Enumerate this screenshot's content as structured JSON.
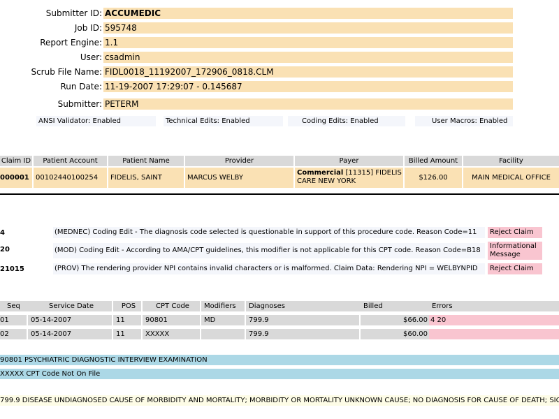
{
  "info": [
    {
      "label": "Submitter ID:",
      "value": "ACCUMEDIC",
      "bold": true
    },
    {
      "label": "Job ID:",
      "value": "595748"
    },
    {
      "label": "Report Engine:",
      "value": "1.1"
    },
    {
      "label": "User:",
      "value": "csadmin"
    },
    {
      "label": "Scrub File Name:",
      "value": "FIDL0018_11192007_172906_0818.CLM"
    },
    {
      "label": "Run Date:",
      "value": "11-19-2007 17:29:07 - 0.145687"
    },
    {
      "label": "Submitter:",
      "value": "PETERM"
    }
  ],
  "status": {
    "ansi": "ANSI Validator: Enabled",
    "technical": "Technical Edits: Enabled",
    "coding": "Coding Edits: Enabled",
    "macros": "User Macros: Enabled"
  },
  "claim_table": {
    "headers": [
      "Claim ID",
      "Patient Account",
      "Patient Name",
      "Provider",
      "Payer",
      "Billed Amount",
      "Facility"
    ],
    "row": {
      "claim_id": "000001",
      "patient_account": "00102440100254",
      "patient_name": "FIDELIS, SAINT",
      "provider": "MARCUS WELBY",
      "payer_bold": "Commercial",
      "payer_line1": " [11315] FIDELIS",
      "payer_line2": "CARE NEW YORK",
      "billed": "$126.00",
      "facility": "MAIN MEDICAL OFFICE"
    }
  },
  "errors": [
    {
      "code": "4",
      "message": "(MEDNEC) Coding Edit - The diagnosis code selected is questionable in support of this procedure code. Reason Code=11",
      "action": "Reject Claim"
    },
    {
      "code": "20",
      "message": "(MOD) Coding Edit - According to AMA/CPT guidelines, this modifier is not applicable for this CPT code. Reason Code=B18",
      "action": "Informational Message"
    },
    {
      "code": "21015",
      "message": "(PROV) The rendering provider NPI contains invalid characters or is malformed. Claim Data: Rendering NPI = WELBYNPID",
      "action": "Reject Claim"
    }
  ],
  "service_table": {
    "headers": [
      "Seq",
      "Service Date",
      "POS",
      "CPT Code",
      "Modifiers",
      "Diagnoses",
      "Billed",
      "Errors"
    ],
    "rows": [
      {
        "seq": "01",
        "date": "05-14-2007",
        "pos": "11",
        "cpt": "90801",
        "mod": "MD",
        "diag": "799.9",
        "billed": "$66.00",
        "errors": "4 20"
      },
      {
        "seq": "02",
        "date": "05-14-2007",
        "pos": "11",
        "cpt": "XXXXX",
        "mod": "",
        "diag": "799.9",
        "billed": "$60.00",
        "errors": ""
      }
    ]
  },
  "descriptions": {
    "cpt1": "90801 PSYCHIATRIC DIAGNOSTIC INTERVIEW EXAMINATION",
    "cpt2": "XXXXX CPT Code Not On File",
    "diag": "799.9 DISEASE UNDIAGNOSED CAUSE OF MORBIDITY AND MORTALITY; MORBIDITY OR MORTALITY UNKNOWN CAUSE; NO DIAGNOSIS FOR CAUSE OF DEATH; SICK"
  },
  "colors": {
    "info_bg": "#fae1b4",
    "header_bg": "#d9d9d9",
    "reject_bg": "#f9c5d0",
    "cpt_bg": "#acd8e6",
    "diag_bg": "#fdfce6"
  }
}
